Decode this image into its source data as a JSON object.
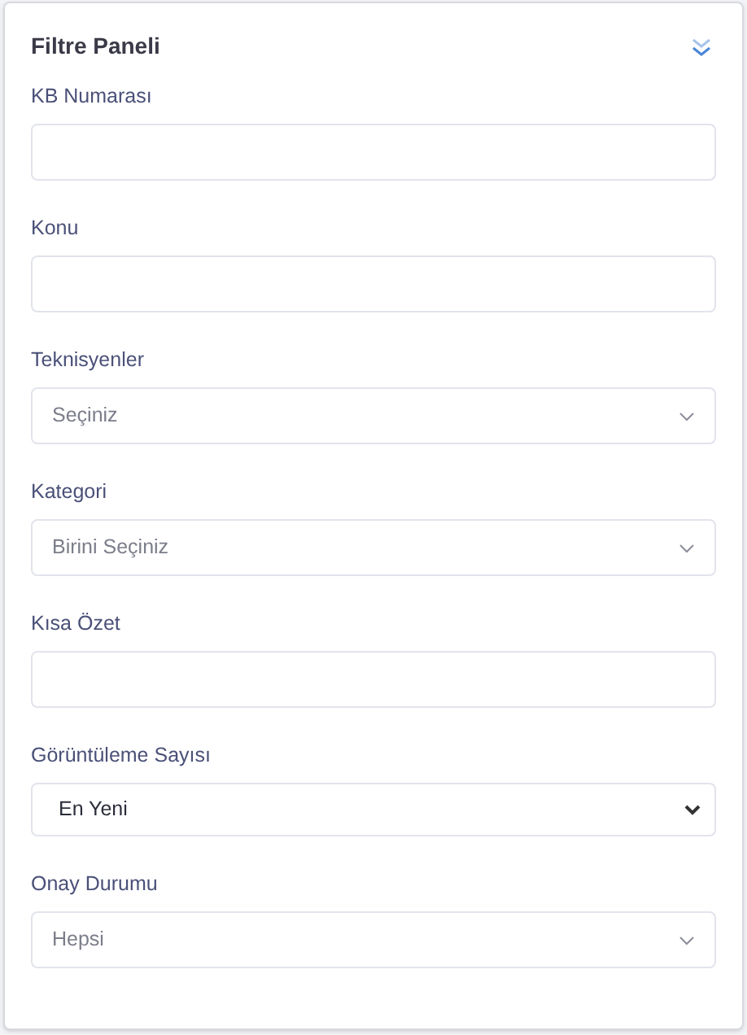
{
  "panel": {
    "title": "Filtre Paneli"
  },
  "fields": [
    {
      "label": "KB Numarası",
      "kind": "text"
    },
    {
      "label": "Konu",
      "kind": "text"
    },
    {
      "label": "Teknisyenler",
      "kind": "select",
      "value": "Seçiniz"
    },
    {
      "label": "Kategori",
      "kind": "select",
      "value": "Birini Seçiniz"
    },
    {
      "label": "Kısa Özet",
      "kind": "text"
    },
    {
      "label": "Görüntüleme Sayısı",
      "kind": "native-select",
      "value": "En Yeni"
    },
    {
      "label": "Onay Durumu",
      "kind": "select",
      "value": "Hepsi"
    }
  ]
}
